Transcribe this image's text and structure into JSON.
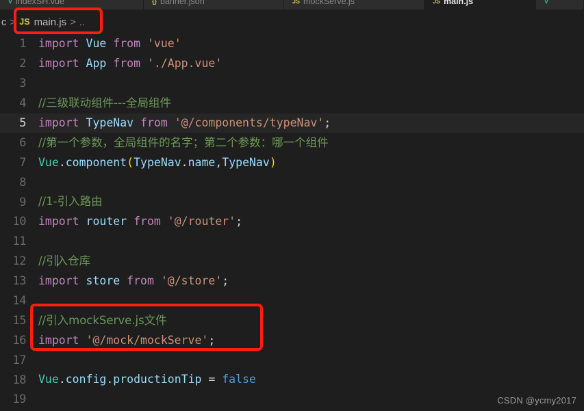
{
  "window": {
    "theme": "dark",
    "background": "#1e1e1e",
    "accent_annotation_color": "#fc1f10"
  },
  "tabs": [
    {
      "label": "indexSH.vue",
      "icon": "vue-file-icon",
      "kind": "vue",
      "active": false
    },
    {
      "label": "banner.json",
      "icon": "json-file-icon",
      "kind": "json",
      "active": false
    },
    {
      "label": "mockServe.js",
      "icon": "js-file-icon",
      "kind": "js",
      "active": false
    },
    {
      "label": "main.js",
      "icon": "js-file-icon",
      "kind": "js",
      "active": true
    },
    {
      "label": "",
      "icon": "vue-file-icon",
      "kind": "vue",
      "active": false
    }
  ],
  "breadcrumb": {
    "prefix": "c",
    "separator": ">",
    "file_icon_label": "JS",
    "file_name": "main.js",
    "trailing": ".."
  },
  "editor": {
    "language": "javascript",
    "active_line": 5,
    "lines": [
      {
        "n": "1",
        "tokens": [
          {
            "t": "import",
            "c": "t-kw"
          },
          {
            "t": " ",
            "c": "t-punct"
          },
          {
            "t": "Vue",
            "c": "t-ident"
          },
          {
            "t": " ",
            "c": "t-punct"
          },
          {
            "t": "from",
            "c": "t-kw"
          },
          {
            "t": " ",
            "c": "t-punct"
          },
          {
            "t": "'vue'",
            "c": "t-str"
          }
        ]
      },
      {
        "n": "2",
        "tokens": [
          {
            "t": "import",
            "c": "t-kw"
          },
          {
            "t": " ",
            "c": "t-punct"
          },
          {
            "t": "App",
            "c": "t-ident"
          },
          {
            "t": " ",
            "c": "t-punct"
          },
          {
            "t": "from",
            "c": "t-kw"
          },
          {
            "t": " ",
            "c": "t-punct"
          },
          {
            "t": "'./App.vue'",
            "c": "t-str"
          }
        ]
      },
      {
        "n": "3",
        "tokens": []
      },
      {
        "n": "4",
        "tokens": [
          {
            "t": "//三级联动组件---全局组件",
            "c": "t-comment cn"
          }
        ]
      },
      {
        "n": "5",
        "tokens": [
          {
            "t": "import",
            "c": "t-kw"
          },
          {
            "t": " ",
            "c": "t-punct"
          },
          {
            "t": "TypeNav",
            "c": "t-ident"
          },
          {
            "t": " ",
            "c": "t-punct"
          },
          {
            "t": "from",
            "c": "t-kw"
          },
          {
            "t": " ",
            "c": "t-punct"
          },
          {
            "t": "'@/components/typeNav'",
            "c": "t-str"
          },
          {
            "t": ";",
            "c": "t-punct"
          }
        ]
      },
      {
        "n": "6",
        "tokens": [
          {
            "t": "//第一个参数，全局组件的名字；第二个参数：哪一个组件",
            "c": "t-comment cn"
          }
        ]
      },
      {
        "n": "7",
        "tokens": [
          {
            "t": "Vue",
            "c": "t-obj"
          },
          {
            "t": ".",
            "c": "t-punct"
          },
          {
            "t": "component",
            "c": "t-prop"
          },
          {
            "t": "(",
            "c": "t-paren"
          },
          {
            "t": "TypeNav",
            "c": "t-ident"
          },
          {
            "t": ".",
            "c": "t-punct"
          },
          {
            "t": "name",
            "c": "t-prop"
          },
          {
            "t": ",",
            "c": "t-punct"
          },
          {
            "t": "TypeNav",
            "c": "t-ident"
          },
          {
            "t": ")",
            "c": "t-paren"
          }
        ]
      },
      {
        "n": "8",
        "tokens": []
      },
      {
        "n": "9",
        "tokens": [
          {
            "t": "//1-引入路由",
            "c": "t-comment cn"
          }
        ]
      },
      {
        "n": "10",
        "tokens": [
          {
            "t": "import",
            "c": "t-kw"
          },
          {
            "t": " ",
            "c": "t-punct"
          },
          {
            "t": "router",
            "c": "t-ident"
          },
          {
            "t": " ",
            "c": "t-punct"
          },
          {
            "t": "from",
            "c": "t-kw"
          },
          {
            "t": " ",
            "c": "t-punct"
          },
          {
            "t": "'@/router'",
            "c": "t-str"
          },
          {
            "t": ";",
            "c": "t-punct"
          }
        ]
      },
      {
        "n": "11",
        "tokens": []
      },
      {
        "n": "12",
        "tokens": [
          {
            "t": "//引",
            "c": "t-comment cn"
          },
          {
            "t": "|CARET|",
            "c": "caret"
          },
          {
            "t": "入仓库",
            "c": "t-comment cn"
          }
        ]
      },
      {
        "n": "13",
        "tokens": [
          {
            "t": "import",
            "c": "t-kw"
          },
          {
            "t": " ",
            "c": "t-punct"
          },
          {
            "t": "store",
            "c": "t-ident"
          },
          {
            "t": " ",
            "c": "t-punct"
          },
          {
            "t": "from",
            "c": "t-kw"
          },
          {
            "t": " ",
            "c": "t-punct"
          },
          {
            "t": "'@/store'",
            "c": "t-str"
          },
          {
            "t": ";",
            "c": "t-punct"
          }
        ]
      },
      {
        "n": "14",
        "tokens": []
      },
      {
        "n": "15",
        "tokens": [
          {
            "t": "//引入mockServe.js文件",
            "c": "t-comment cn"
          }
        ]
      },
      {
        "n": "16",
        "tokens": [
          {
            "t": "import",
            "c": "t-kw"
          },
          {
            "t": " ",
            "c": "t-punct"
          },
          {
            "t": "'@/mock/mockServe'",
            "c": "t-str"
          },
          {
            "t": ";",
            "c": "t-punct"
          }
        ]
      },
      {
        "n": "17",
        "tokens": []
      },
      {
        "n": "18",
        "tokens": [
          {
            "t": "Vue",
            "c": "t-obj"
          },
          {
            "t": ".",
            "c": "t-punct"
          },
          {
            "t": "config",
            "c": "t-prop"
          },
          {
            "t": ".",
            "c": "t-punct"
          },
          {
            "t": "productionTip",
            "c": "t-prop"
          },
          {
            "t": " = ",
            "c": "t-punct"
          },
          {
            "t": "false",
            "c": "t-bool"
          }
        ]
      },
      {
        "n": "19",
        "tokens": []
      }
    ]
  },
  "annotations": [
    {
      "id": "anno-breadcrumb",
      "target": "breadcrumb-main-js",
      "color": "#fc1f10"
    },
    {
      "id": "anno-mock",
      "target": "mock-serve-import-lines",
      "color": "#fc1f10"
    }
  ],
  "watermark": {
    "text": "CSDN @ycmy2017"
  }
}
